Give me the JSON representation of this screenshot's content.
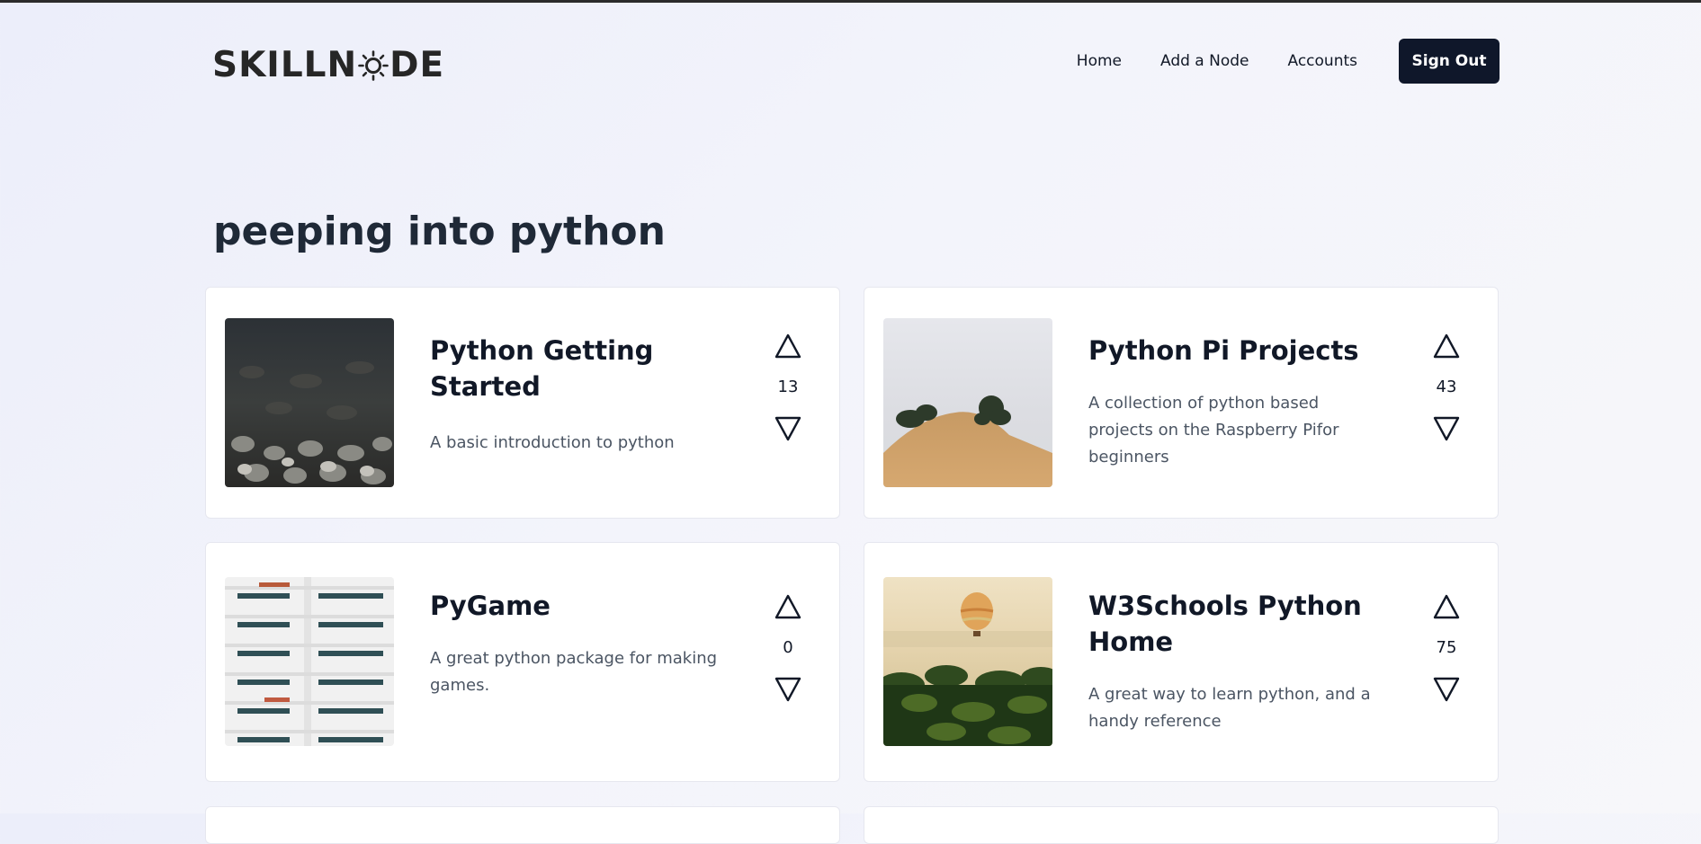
{
  "header": {
    "logo_left": "SKILLN",
    "logo_right": "DE",
    "nav": [
      {
        "label": "Home"
      },
      {
        "label": "Add a Node"
      },
      {
        "label": "Accounts"
      }
    ],
    "sign_out_label": "Sign Out"
  },
  "page": {
    "title": "peeping into python"
  },
  "cards": [
    {
      "title": "Python Getting Started",
      "description": "A basic introduction to python",
      "votes": "13",
      "image": "dark-pebbles-photo"
    },
    {
      "title": "Python Pi Projects",
      "description": "A collection of python based projects on the Raspberry Pifor beginners",
      "votes": "43",
      "image": "foggy-desert-hill-photo"
    },
    {
      "title": "PyGame",
      "description": "A great python package for making games.",
      "votes": "0",
      "image": "white-building-facade-photo"
    },
    {
      "title": "W3Schools Python Home",
      "description": "A great way to learn python, and a handy reference",
      "votes": "75",
      "image": "hot-air-balloon-palms-photo"
    }
  ],
  "icons": {
    "upvote": "triangle-up-icon",
    "downvote": "triangle-down-icon"
  },
  "colors": {
    "accent": "#0f172a",
    "text": "#111827",
    "muted": "#4b5563"
  }
}
